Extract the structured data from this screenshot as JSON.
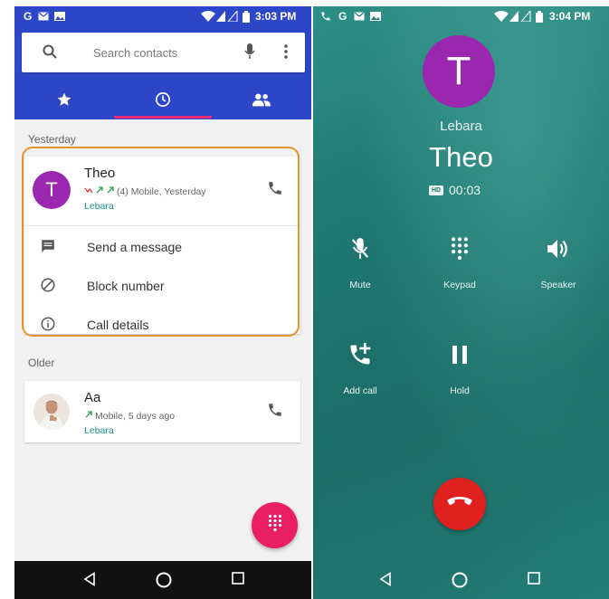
{
  "left": {
    "status_bar": {
      "time": "3:03 PM",
      "icons": [
        "g-icon",
        "mail-icon",
        "image-icon",
        "wifi-icon",
        "signal-icon",
        "battery-icon"
      ]
    },
    "search": {
      "placeholder": "Search contacts"
    },
    "tabs": [
      {
        "icon": "star-icon",
        "label": "Favorites"
      },
      {
        "icon": "clock-icon",
        "label": "Recents",
        "selected": true
      },
      {
        "icon": "people-icon",
        "label": "Contacts"
      }
    ],
    "sections": {
      "yesterday": "Yesterday",
      "older": "Older"
    },
    "recent_theo": {
      "initial": "T",
      "name": "Theo",
      "meta": "(4) Mobile, Yesterday",
      "sim": "Lebara",
      "actions": [
        {
          "icon": "message-icon",
          "label": "Send a message"
        },
        {
          "icon": "block-icon",
          "label": "Block number"
        },
        {
          "icon": "info-icon",
          "label": "Call details"
        }
      ]
    },
    "recent_aa": {
      "name": "Aa",
      "meta": "Mobile, 5 days ago",
      "sim": "Lebara"
    }
  },
  "right": {
    "status_bar": {
      "time": "3:04 PM",
      "icons": [
        "call-icon",
        "g-icon",
        "mail-icon",
        "image-icon",
        "wifi-icon",
        "signal-icon",
        "battery-icon"
      ]
    },
    "avatar_initial": "T",
    "carrier": "Lebara",
    "name": "Theo",
    "hd_badge": "HD",
    "timer": "00:03",
    "controls": [
      {
        "icon": "mic-off-icon",
        "label": "Mute"
      },
      {
        "icon": "dialpad-icon",
        "label": "Keypad"
      },
      {
        "icon": "speaker-icon",
        "label": "Speaker"
      },
      {
        "icon": "add-call-icon",
        "label": "Add call"
      },
      {
        "icon": "pause-icon",
        "label": "Hold"
      }
    ]
  },
  "colors": {
    "primary_blue": "#2e46c8",
    "accent_pink": "#e91e63",
    "avatar_purple": "#9b27b0",
    "teal": "#1f7a73",
    "end_call_red": "#e0201e",
    "highlight_orange": "#e8922a"
  }
}
